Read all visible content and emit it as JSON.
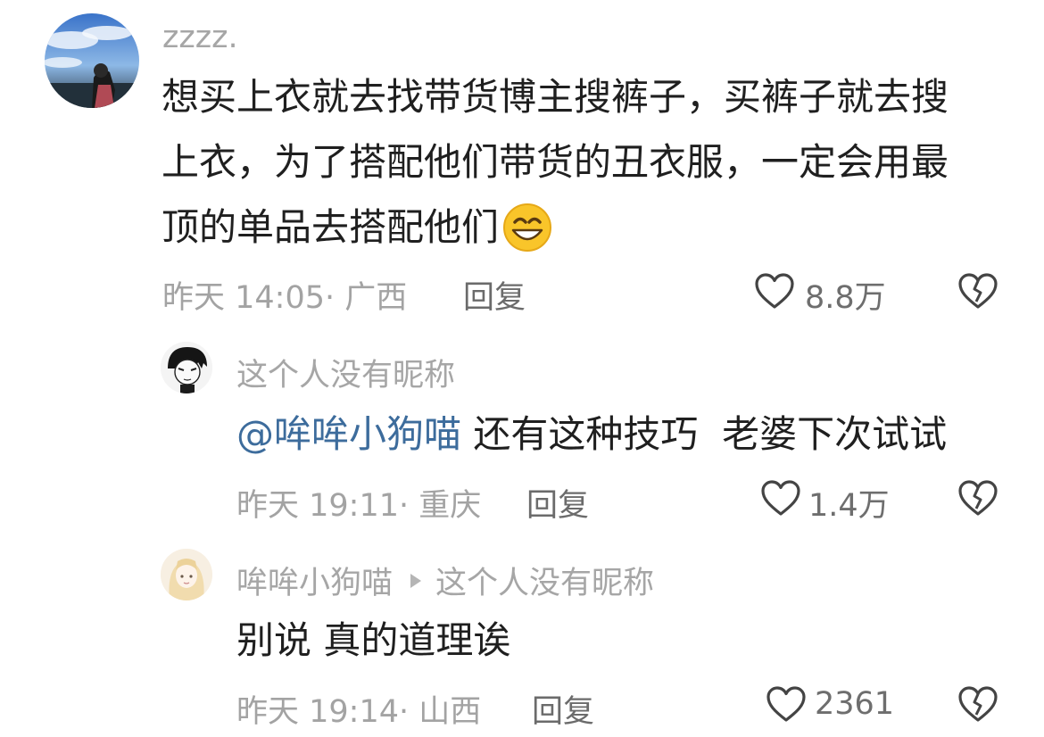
{
  "comments": [
    {
      "username": "zzzz.",
      "content": "想买上衣就去找带货博主搜裤子，买裤子就去搜上衣，为了搭配他们带货的丑衣服，一定会用最顶的单品去搭配他们",
      "lines": [
        "想买上衣就去找带货博主搜裤子，买裤子就去搜",
        "上衣，为了搭配他们带货的丑衣服，一定会用最",
        "顶的单品去搭配他们"
      ],
      "time": "昨天 14:05",
      "location": "广西",
      "reply_label": "回复",
      "likes": "8.8万"
    }
  ],
  "replies": [
    {
      "username": "这个人没有昵称",
      "mention": "@哞哞小狗喵",
      "content": "还有这种技巧  老婆下次试试",
      "time": "昨天 19:11",
      "location": "重庆",
      "reply_label": "回复",
      "likes": "1.4万"
    },
    {
      "username": "哞哞小狗喵",
      "reply_to": "这个人没有昵称",
      "content": "别说 真的道理诶",
      "time": "昨天 19:14",
      "location": "山西",
      "reply_label": "回复",
      "likes": "2361"
    }
  ],
  "icons": {
    "like": "heart-outline-icon",
    "dislike": "broken-heart-icon",
    "reply_arrow": "play-triangle-icon",
    "emoji": "grinning-face-emoji"
  },
  "colors": {
    "mention": "#3d6c9c",
    "meta": "#a3a3a3",
    "content": "#1f1f1f"
  }
}
